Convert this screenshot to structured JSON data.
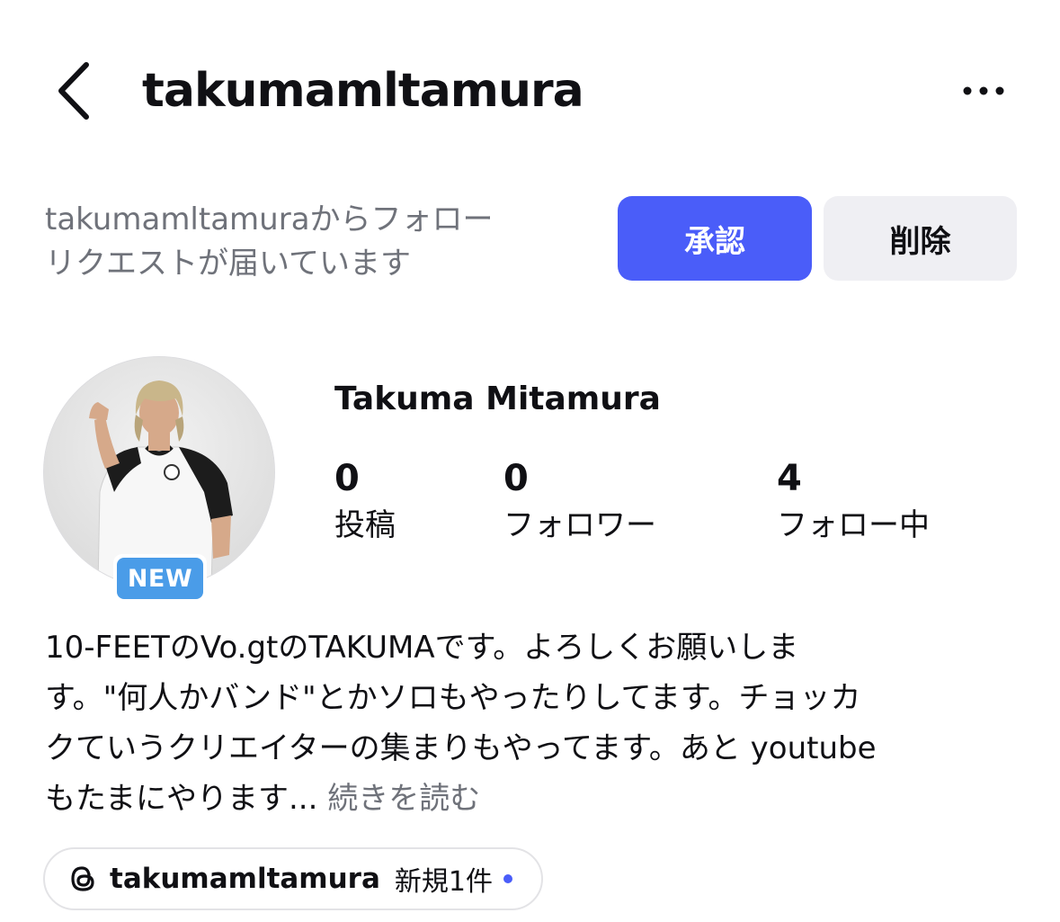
{
  "header": {
    "username": "takumamltamura"
  },
  "request": {
    "line1": "takumamltamuraからフォロー",
    "line2": "リクエストが届いています",
    "approve_label": "承認",
    "delete_label": "削除"
  },
  "profile": {
    "new_badge": "NEW",
    "full_name": "Takuma Mitamura",
    "stats": [
      {
        "count": "0",
        "label": "投稿"
      },
      {
        "count": "0",
        "label": "フォロワー"
      },
      {
        "count": "4",
        "label": "フォロー中"
      }
    ],
    "bio_lines": [
      "10-FEETのVo.gtのTAKUMAです。よろしくお願いしま",
      "す。\"何人かバンド\"とかソロもやったりしてます。チョッカ",
      "クていうクリエイターの集まりもやってます。あと youtube"
    ],
    "bio_last_line": "もたまにやります...",
    "read_more": "続きを読む"
  },
  "threads": {
    "handle": "takumamltamura",
    "new_posts": "新規1件",
    "dot_color": "#4a5df9"
  },
  "colors": {
    "accent": "#4a5df9",
    "badge": "#4a9ce8",
    "secondary_text": "#6f727a"
  }
}
